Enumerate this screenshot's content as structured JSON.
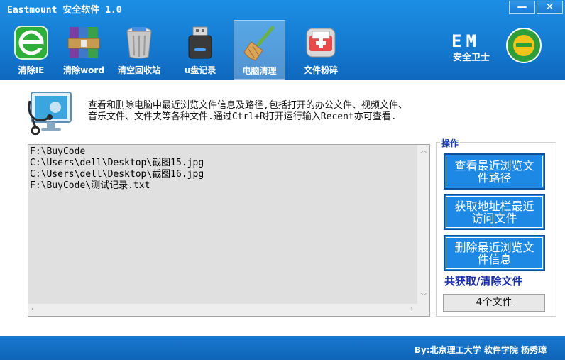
{
  "window": {
    "title": "Eastmount 安全软件 1.0",
    "min_label": "—",
    "close_label": "✕"
  },
  "nav": [
    {
      "label": "清除IE",
      "icon": "ie-icon"
    },
    {
      "label": "清除word",
      "icon": "archive-icon"
    },
    {
      "label": "清空回收站",
      "icon": "recycle-bin-icon"
    },
    {
      "label": "u盘记录",
      "icon": "usb-drive-icon"
    },
    {
      "label": "电脑清理",
      "icon": "broom-icon",
      "active": true
    },
    {
      "label": "文件粉碎",
      "icon": "shredder-icon"
    }
  ],
  "logo": {
    "text": "EM",
    "sub": "安全卫士"
  },
  "description": {
    "line1": "查看和删除电脑中最近浏览文件信息及路径,包括打开的办公文件、视频文件、",
    "line2": "音乐文件、文件夹等各种文件.通过Ctrl+R打开运行输入Recent亦可查看."
  },
  "file_list": [
    "F:\\BuyCode",
    "C:\\Users\\dell\\Desktop\\截图15.jpg",
    "C:\\Users\\dell\\Desktop\\截图16.jpg",
    "F:\\BuyCode\\测试记录.txt"
  ],
  "operations": {
    "title": "操作",
    "view_recent_label": "查看最近浏览文件路径",
    "get_address_bar_label": "获取地址栏最近访问文件",
    "delete_recent_label": "删除最近浏览文件信息",
    "result_label": "共获取/清除文件",
    "result_value": "4个文件"
  },
  "footer": {
    "text": "By:北京理工大学 软件学院 杨秀璋"
  },
  "colors": {
    "header_blue": "#1479cf",
    "button_blue": "#1e88e5",
    "label_navy": "#1b2fa8"
  }
}
